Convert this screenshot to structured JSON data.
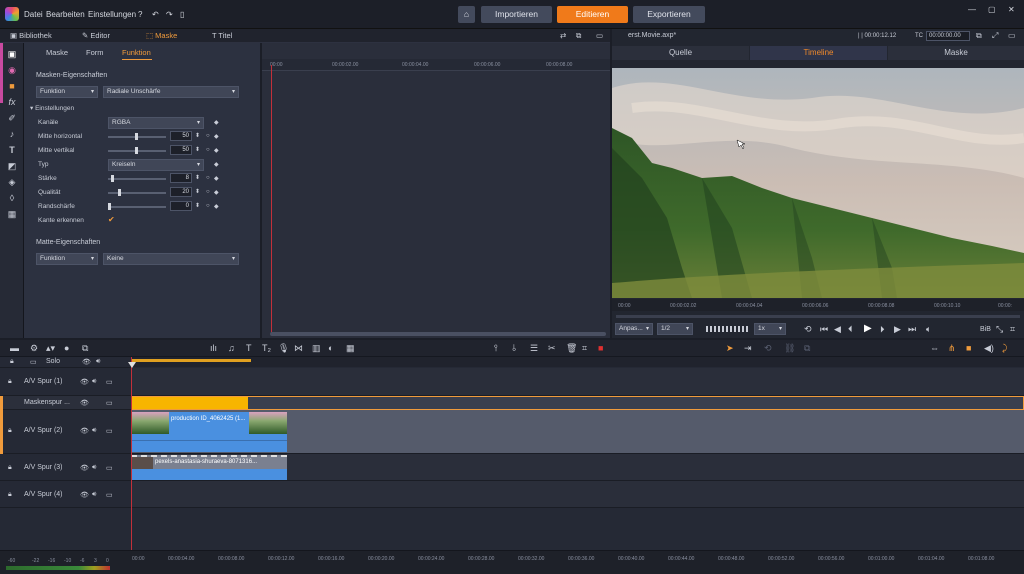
{
  "app": {
    "menu": [
      "Datei",
      "Bearbeiten",
      "Einstellungen"
    ],
    "nav_buttons": {
      "import": "Importieren",
      "edit": "Editieren",
      "export": "Exportieren"
    },
    "accent": "#f07a1a"
  },
  "left_tabs": {
    "library": "Bibliothek",
    "editor": "Editor",
    "mask": "Maske",
    "title": "Titel"
  },
  "sub_tabs": {
    "mask": "Maske",
    "form": "Form",
    "function": "Funktion"
  },
  "mask_props": {
    "section_title": "Masken-Eigenschaften",
    "function_select": "Funktion",
    "effect_select": "Radiale Unschärfe",
    "settings_label": "Einstellungen",
    "rows": [
      {
        "label": "Kanäle",
        "value": "RGBA"
      },
      {
        "label": "Mitte horizontal",
        "value": "50"
      },
      {
        "label": "Mitte vertikal",
        "value": "50"
      },
      {
        "label": "Typ",
        "value": "Kreiseln"
      },
      {
        "label": "Stärke",
        "value": "8"
      },
      {
        "label": "Qualität",
        "value": "20"
      },
      {
        "label": "Randschärfe",
        "value": "0"
      },
      {
        "label": "Kante erkennen",
        "value": ""
      }
    ],
    "matte_title": "Matte-Eigenschaften",
    "matte_function": "Funktion",
    "matte_value": "Keine"
  },
  "mask_ruler": [
    "00:00",
    "00:00:02.00",
    "00:00:04.00",
    "00:00:06.00",
    "00:00:08.00"
  ],
  "right_panel": {
    "project": "erst.Movie.axp*",
    "timecode": "00:00:12.12",
    "tc_label": "TC",
    "tc_value": "00:00:00.00",
    "tabs": {
      "source": "Quelle",
      "timeline": "Timeline",
      "mask": "Maske"
    },
    "ruler": [
      "00:00",
      "00:00:02.02",
      "00:00:04.04",
      "00:00:06.06",
      "00:00:08.08",
      "00:00:10.10",
      "00:00:"
    ],
    "fit": "Anpas...",
    "ratio": "1/2",
    "speed": "1x",
    "bib": "BiB"
  },
  "timeline": {
    "tracks": [
      {
        "name": "Solo"
      },
      {
        "name": "A/V Spur (1)"
      },
      {
        "name": "Maskenspur ..."
      },
      {
        "name": "A/V Spur (2)"
      },
      {
        "name": "A/V Spur (3)"
      },
      {
        "name": "A/V Spur (4)"
      }
    ],
    "clip1": "production ID_4062425 (1...",
    "clip2": "pexels-anastasia-shuraeva-8071316...",
    "ruler": [
      "00:00",
      "00:00:04.00",
      "00:00:08.00",
      "00:00:12.00",
      "00:00:16.00",
      "00:00:20.00",
      "00:00:24.00",
      "00:00:28.00",
      "00:00:32.00",
      "00:00:36.00",
      "00:00:40.00",
      "00:00:44.00",
      "00:00:48.00",
      "00:00:52.00",
      "00:00:56.00",
      "00:01:00.00",
      "00:01:04.00",
      "00:01:08.00"
    ],
    "meter_scale": [
      "-60",
      "-22",
      "-16",
      "-10",
      "-6",
      "3",
      "0"
    ]
  }
}
